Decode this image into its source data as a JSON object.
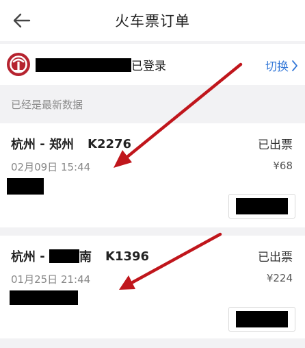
{
  "header": {
    "title": "火车票订单"
  },
  "account": {
    "status_text": "已登录",
    "switch_label": "切换"
  },
  "notice": {
    "text": "已经是最新数据"
  },
  "orders": [
    {
      "from": "杭州",
      "to": "郑州",
      "separator": " - ",
      "train": "K2276",
      "status": "已出票",
      "datetime": "02月09日 15:44",
      "price": "¥68"
    },
    {
      "from": "杭州",
      "to_suffix": "南",
      "separator": " - ",
      "train": "K1396",
      "status": "已出票",
      "datetime": "01月25日 21:44",
      "price": "¥224"
    }
  ],
  "colors": {
    "accent": "#3478d8",
    "logo": "#b6232f",
    "arrow": "#c0161c"
  }
}
